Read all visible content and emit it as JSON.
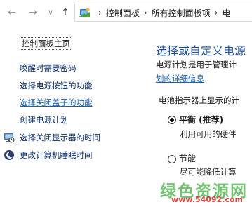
{
  "nav": {
    "back_glyph": "←",
    "forward_glyph": "→",
    "recent_glyph": "∨",
    "up_glyph": "↑"
  },
  "address": {
    "separator_glyph": "›",
    "crumbs": [
      "控制面板",
      "所有控制面板项",
      "电"
    ]
  },
  "sidebar": {
    "home": "控制面板主页",
    "links": [
      "唤醒时需要密码",
      "选择电源按钮的功能",
      "选择关闭盖子的功能",
      "创建电源计划",
      "选择关闭显示器的时间",
      "更改计算机睡眠时间"
    ]
  },
  "main": {
    "title": "选择或自定义电源",
    "description": "电源计划是用于管理计",
    "link_more": "划的详细信息",
    "group_label": "电池指示器上显示的计",
    "plans": [
      {
        "name": "平衡 (推荐)",
        "desc": "利用可用的硬件",
        "selected": true
      },
      {
        "name": "节能",
        "desc": "尽可能降低计算",
        "selected": false
      }
    ]
  },
  "watermark": {
    "text": "绿色资源网",
    "url": "www.54092.com"
  },
  "colors": {
    "title_blue": "#1e4f9a",
    "link_blue": "#1b5fb0",
    "watermark_green": "#5cb85c",
    "watermark_red": "#d9342b"
  }
}
